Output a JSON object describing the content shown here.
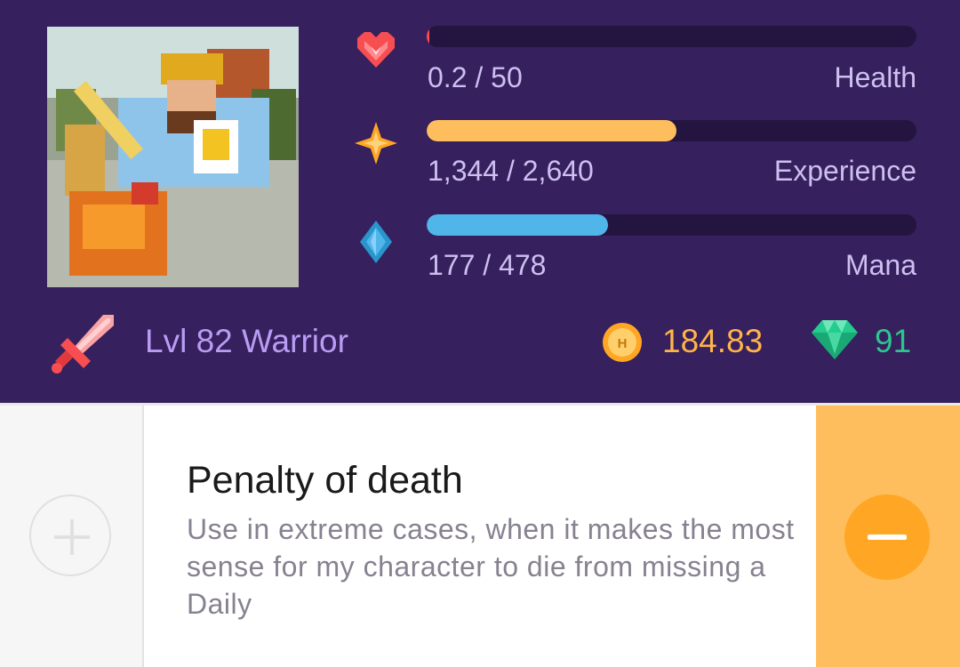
{
  "avatar": {
    "icon": "pixel-warrior-avatar"
  },
  "stats": {
    "health": {
      "value_text": "0.2 / 50",
      "label": "Health",
      "current": 0.2,
      "max": 50,
      "color": "#f74e52",
      "icon": "heart-icon"
    },
    "experience": {
      "value_text": "1,344 / 2,640",
      "label": "Experience",
      "current": 1344,
      "max": 2640,
      "color": "#ffbe5d",
      "icon": "star-icon"
    },
    "mana": {
      "value_text": "177 / 478",
      "label": "Mana",
      "current": 177,
      "max": 478,
      "color": "#50b5e9",
      "icon": "mana-drop-icon"
    }
  },
  "character": {
    "level_text": "Lvl 82 Warrior",
    "icon": "sword-icon"
  },
  "currency": {
    "gold": {
      "value": "184.83",
      "icon": "gold-coin-icon",
      "color": "#ffb44a"
    },
    "gems": {
      "value": "91",
      "icon": "gem-icon",
      "color": "#2cc58e"
    }
  },
  "task": {
    "title": "Penalty of death",
    "notes": "Use in extreme cases, when it makes the most sense for my character to die from missing a Daily",
    "positive_icon": "plus-icon",
    "negative_icon": "minus-icon"
  }
}
